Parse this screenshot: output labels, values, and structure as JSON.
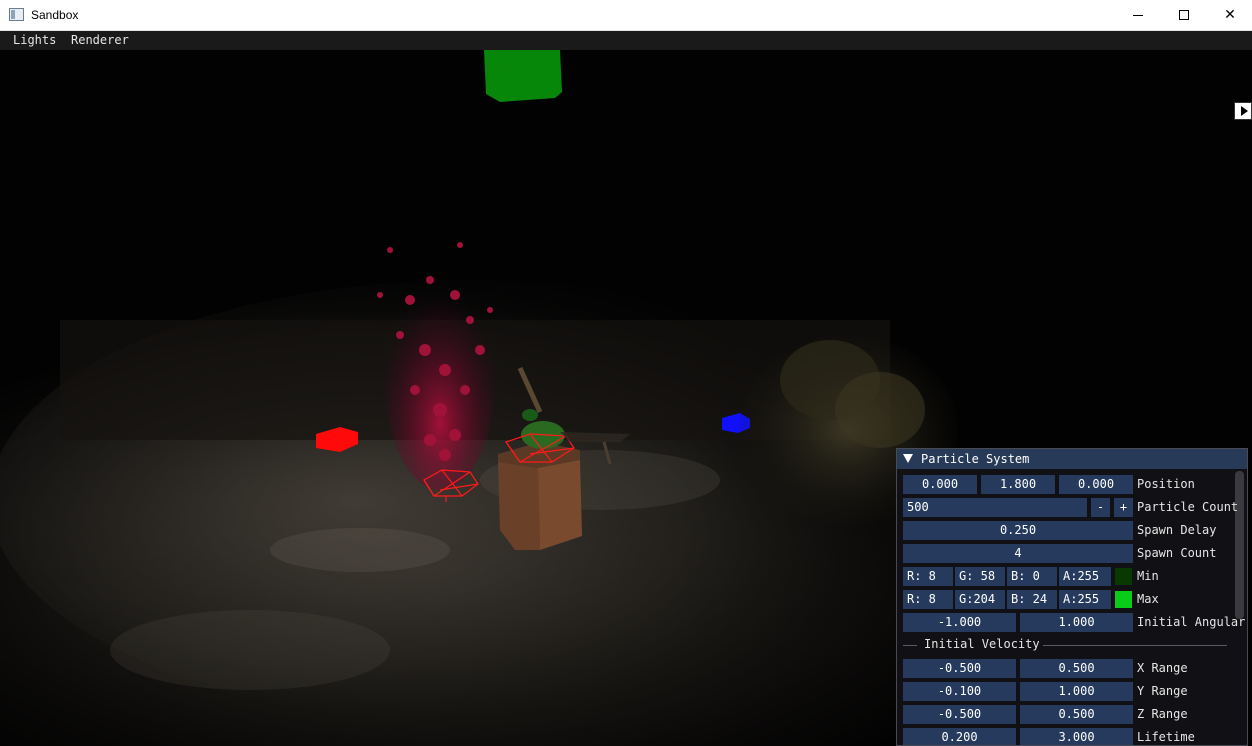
{
  "window": {
    "title": "Sandbox",
    "close_glyph": "✕"
  },
  "menu": {
    "items": [
      "Lights",
      "Renderer"
    ]
  },
  "panel": {
    "title": "Particle System",
    "position": {
      "values": [
        "0.000",
        "1.800",
        "0.000"
      ],
      "label": "Position"
    },
    "particle_count": {
      "value": "500",
      "minus": "-",
      "plus": "+",
      "label": "Particle Count"
    },
    "spawn_delay": {
      "value": "0.250",
      "label": "Spawn Delay"
    },
    "spawn_count": {
      "value": "4",
      "label": "Spawn Count"
    },
    "color_min": {
      "r": "R:  8",
      "g": "G: 58",
      "b": "B:  0",
      "a": "A:255",
      "swatch": "#083a00",
      "label": "Min"
    },
    "color_max": {
      "r": "R:  8",
      "g": "G:204",
      "b": "B: 24",
      "a": "A:255",
      "swatch": "#08cc18",
      "label": "Max"
    },
    "initial_angular": {
      "min": "-1.000",
      "max": "1.000",
      "label": "Initial Angular"
    },
    "velocity_header": "Initial Velocity",
    "x_range": {
      "min": "-0.500",
      "max": "0.500",
      "label": "X Range"
    },
    "y_range": {
      "min": "-0.100",
      "max": "1.000",
      "label": "Y Range"
    },
    "z_range": {
      "min": "-0.500",
      "max": "0.500",
      "label": "Z Range"
    },
    "lifetime": {
      "min": "0.200",
      "max": "3.000",
      "label": "Lifetime"
    }
  }
}
